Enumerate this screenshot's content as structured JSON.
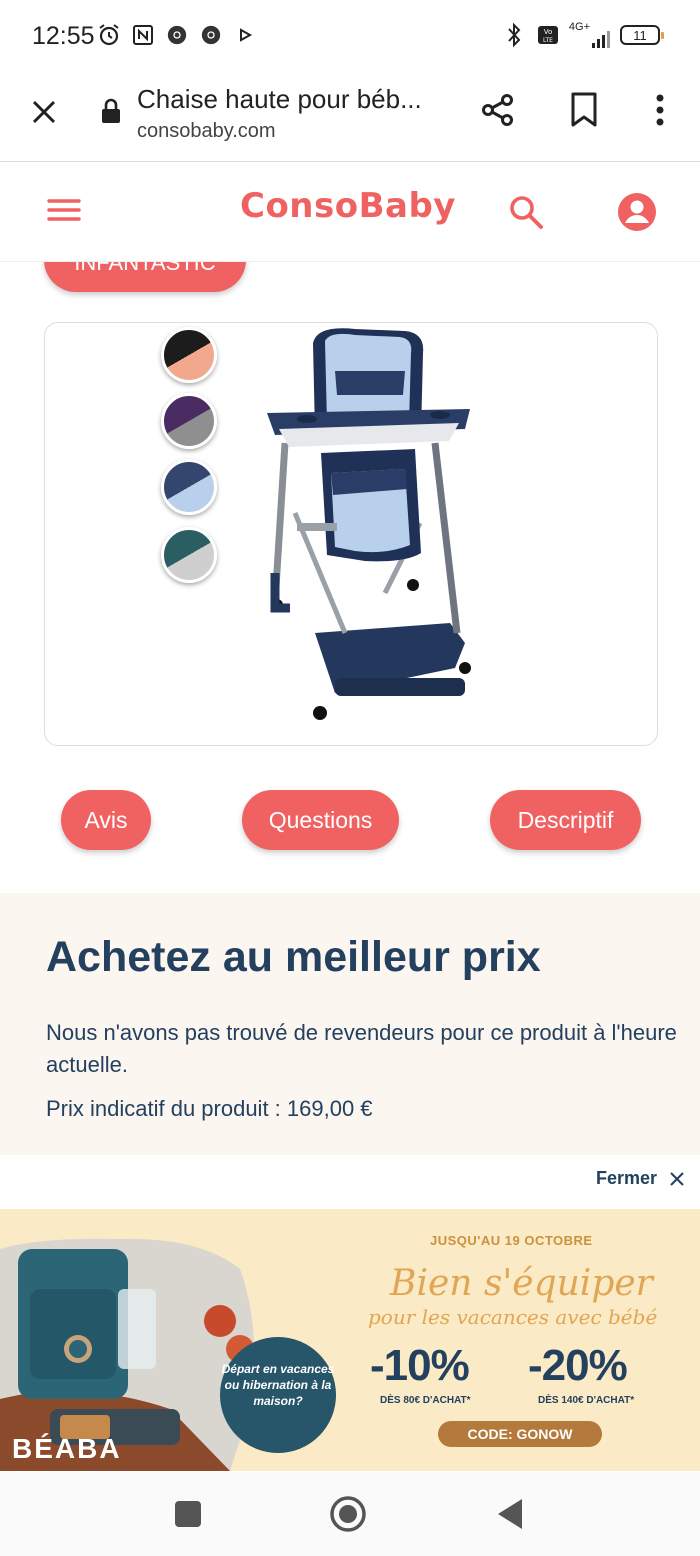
{
  "status_bar": {
    "time": "12:55",
    "network": "4G+",
    "volte": "Vo LTE",
    "battery": "11"
  },
  "browser": {
    "page_title": "Chaise haute pour béb...",
    "domain": "consobaby.com"
  },
  "site": {
    "logo": "ConsoBaby",
    "brand_pill": "INFANTASTIC"
  },
  "product": {
    "color_swatches": [
      {
        "top": "#1c1c1c",
        "bottom": "#f2a88c"
      },
      {
        "top": "#4a2c63",
        "bottom": "#8f8f8f"
      },
      {
        "top": "#34466e",
        "bottom": "#b9d0ec"
      },
      {
        "top": "#2a5e63",
        "bottom": "#cfcfcf"
      }
    ]
  },
  "tabs": [
    {
      "label": "Avis"
    },
    {
      "label": "Questions"
    },
    {
      "label": "Descriptif"
    }
  ],
  "price": {
    "heading": "Achetez au meilleur prix",
    "text": "Nous n'avons pas trouvé de revendeurs pour ce produit à l'heure actuelle.",
    "indicative": "Prix indicatif du produit : 169,00 €"
  },
  "ad": {
    "close_label": "Fermer",
    "date": "JUSQU'AU 19 OCTOBRE",
    "title1": "Bien s'équiper",
    "title2": "pour les vacances avec bébé",
    "promo1": "-10%",
    "promo1_note": "DÈS 80€ D'ACHAT*",
    "promo2": "-20%",
    "promo2_note": "DÈS 140€ D'ACHAT*",
    "code": "CODE: GONOW",
    "bubble": "Départ en vacances ou hibernation à la maison?",
    "brand": "BÉABA"
  },
  "colors": {
    "accent": "#f06262",
    "navy": "#23405f",
    "price_bg": "#fcf6f1",
    "ad_bg": "#fbeac6"
  }
}
